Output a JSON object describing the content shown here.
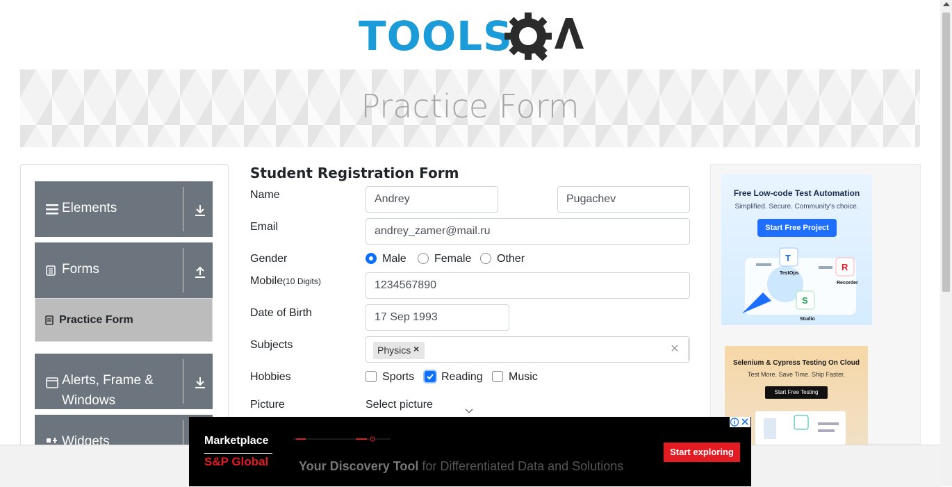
{
  "logo": {
    "text": "TOOLS",
    "suffix": "A"
  },
  "banner": {
    "title": "Practice Form"
  },
  "sidebar": {
    "groups": [
      {
        "label": "Elements"
      },
      {
        "label": "Forms"
      },
      {
        "label": "Alerts, Frame &",
        "label2": "Windows"
      },
      {
        "label": "Widgets"
      }
    ],
    "active_item": "Practice Form"
  },
  "form": {
    "title": "Student Registration Form",
    "name_label": "Name",
    "first_name": "Andrey",
    "last_name": "Pugachev",
    "email_label": "Email",
    "email": "andrey_zamer@mail.ru",
    "gender_label": "Gender",
    "genders": [
      "Male",
      "Female",
      "Other"
    ],
    "gender_selected": "Male",
    "mobile_label": "Mobile",
    "mobile_hint": "(10 Digits)",
    "mobile": "1234567890",
    "dob_label": "Date of Birth",
    "dob": "17 Sep 1993",
    "subjects_label": "Subjects",
    "subject_tags": [
      "Physics"
    ],
    "subjects_clear": "×",
    "tag_remove": "×",
    "hobbies_label": "Hobbies",
    "hobbies": [
      "Sports",
      "Reading",
      "Music"
    ],
    "hobbies_checked": [
      "Reading"
    ],
    "picture_label": "Picture",
    "picture_button": "Select picture"
  },
  "ads": {
    "right_top": {
      "headline": "Free Low-code Test Automation",
      "sub": "Simplified. Secure. Community's choice.",
      "cta": "Start Free Project",
      "labels": [
        "TestOps",
        "Recorder",
        "Studio"
      ]
    },
    "right_bottom": {
      "headline": "Selenium & Cypress Testing On Cloud",
      "sub": "Test More. Save Time. Ship Faster.",
      "cta": "Start Free Testing"
    },
    "bottom": {
      "brand1": "Marketplace",
      "brand2": "S&P Global",
      "tagline_bold": "Your Discovery Tool",
      "tagline_rest": " for Differentiated Data and Solutions",
      "cta": "Start exploring"
    }
  },
  "colors": {
    "sidebar_group": "#6c757d",
    "accent": "#0d6efd",
    "logo_blue": "#1b9bd7",
    "ad_red": "#e31b23"
  }
}
